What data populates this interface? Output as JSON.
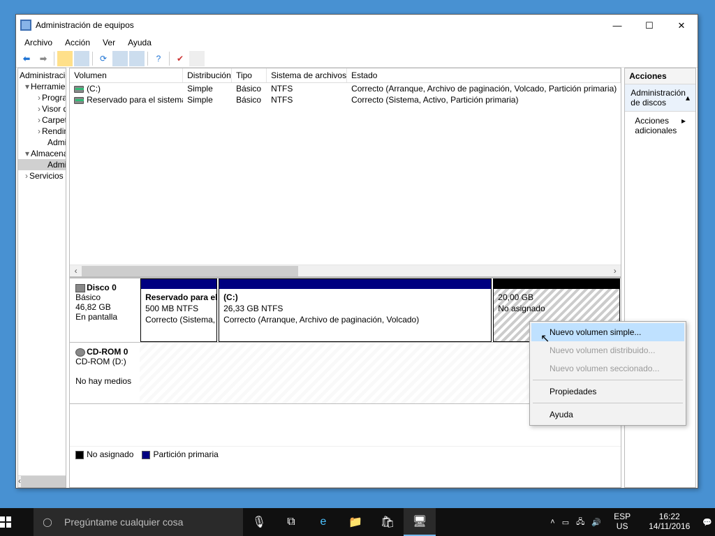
{
  "window": {
    "title": "Administración de equipos",
    "menu": [
      "Archivo",
      "Acción",
      "Ver",
      "Ayuda"
    ]
  },
  "tree": {
    "root": "Administración del equipo (local)",
    "tools": "Herramientas del sistema",
    "tools_items": [
      "Programador de tareas",
      "Visor de eventos",
      "Carpetas compartidas",
      "Rendimiento",
      "Administrador de dispositivos"
    ],
    "storage": "Almacenamiento",
    "disk_mgmt": "Administración de discos",
    "services": "Servicios y Aplicaciones"
  },
  "columns": {
    "c0": "Volumen",
    "c1": "Distribución",
    "c2": "Tipo",
    "c3": "Sistema de archivos",
    "c4": "Estado"
  },
  "volumes": [
    {
      "name": "(C:)",
      "layout": "Simple",
      "type": "Básico",
      "fs": "NTFS",
      "status": "Correcto (Arranque, Archivo de paginación, Volcado, Partición primaria)"
    },
    {
      "name": "Reservado para el sistema",
      "layout": "Simple",
      "type": "Básico",
      "fs": "NTFS",
      "status": "Correcto (Sistema, Activo, Partición primaria)"
    }
  ],
  "disk0": {
    "label": "Disco 0",
    "type": "Básico",
    "size": "46,82 GB",
    "state": "En pantalla",
    "p0": {
      "name": "Reservado para el sistema",
      "size": "500 MB NTFS",
      "status": "Correcto (Sistema, Activo, Partición primaria)"
    },
    "p1": {
      "name": "(C:)",
      "size": "26,33 GB NTFS",
      "status": "Correcto (Arranque, Archivo de paginación, Volcado)"
    },
    "p2": {
      "size": "20,00 GB",
      "status": "No asignado"
    }
  },
  "cdrom": {
    "label": "CD-ROM 0",
    "dev": "CD-ROM (D:)",
    "state": "No hay medios"
  },
  "legend": {
    "unalloc": "No asignado",
    "primary": "Partición primaria"
  },
  "actions": {
    "header": "Acciones",
    "section": "Administración de discos",
    "more": "Acciones adicionales"
  },
  "context_menu": {
    "m0": "Nuevo volumen simple...",
    "m1": "Nuevo volumen distribuido...",
    "m2": "Nuevo volumen seccionado...",
    "m3": "Propiedades",
    "m4": "Ayuda"
  },
  "taskbar": {
    "search_placeholder": "Pregúntame cualquier cosa",
    "lang1": "ESP",
    "lang2": "US",
    "time": "16:22",
    "date": "14/11/2016"
  }
}
